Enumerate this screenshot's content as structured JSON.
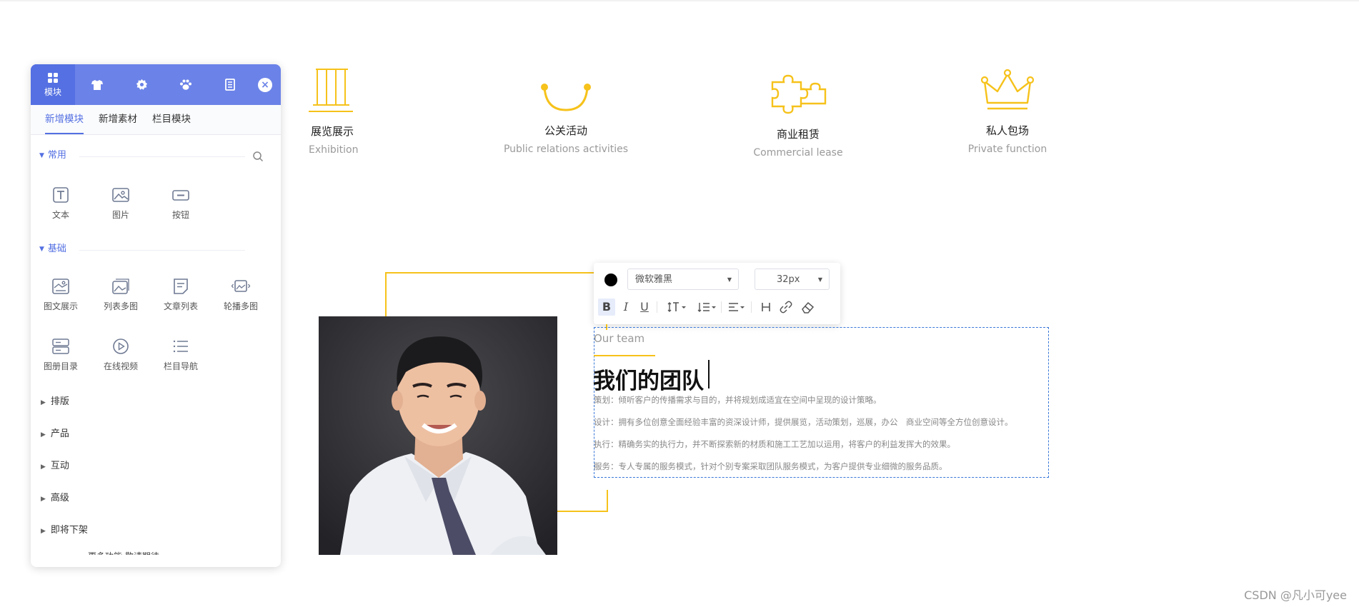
{
  "panel": {
    "head_tabs": [
      {
        "label": "模块",
        "icon": "grid-icon"
      },
      {
        "label": "",
        "icon": "shirt-icon"
      },
      {
        "label": "",
        "icon": "gear-icon"
      },
      {
        "label": "",
        "icon": "paw-icon"
      },
      {
        "label": "",
        "icon": "book-icon"
      }
    ],
    "close_icon": "×",
    "sub_tabs": [
      "新增模块",
      "新增素材",
      "栏目模块"
    ],
    "sections": {
      "common": {
        "title": "常用",
        "items": [
          "文本",
          "图片",
          "按钮"
        ]
      },
      "basic": {
        "title": "基础",
        "items": [
          "图文展示",
          "列表多图",
          "文章列表",
          "轮播多图",
          "图册目录",
          "在线视频",
          "栏目导航"
        ]
      }
    },
    "collapsed": [
      "排版",
      "产品",
      "互动",
      "高级",
      "即将下架"
    ],
    "cut_text": "更多功能 敬请期待"
  },
  "services": [
    {
      "cn": "展览展示",
      "en": "Exhibition",
      "icon": "columns-icon"
    },
    {
      "cn": "公关活动",
      "en": "Public relations activities",
      "icon": "smile-icon"
    },
    {
      "cn": "商业租赁",
      "en": "Commercial lease",
      "icon": "puzzle-icon"
    },
    {
      "cn": "私人包场",
      "en": "Private function",
      "icon": "crown-icon"
    }
  ],
  "toolbar": {
    "font": "微软雅黑",
    "size": "32px",
    "buttons": [
      "B",
      "I",
      "U"
    ]
  },
  "team": {
    "subtitle": "Our team",
    "title": "我们的团队",
    "lines": [
      "策划：倾听客户的传播需求与目的，并将规划成适宜在空间中呈现的设计策略。",
      "设计：拥有多位创意全面经验丰富的资深设计师，提供展览，活动策划，巡展，办公　商业空间等全方位创意设计。",
      "执行：精确务实的执行力，并不断探索新的材质和施工工艺加以运用，将客户的利益发挥大的效果。",
      "服务：专人专属的服务模式，针对个别专案采取团队服务模式，为客户提供专业细微的服务品质。"
    ]
  },
  "watermark": "CSDN @凡小可yee",
  "colors": {
    "accent": "#6b83e8",
    "gold": "#f6c21b",
    "selection": "#3a78d8"
  }
}
